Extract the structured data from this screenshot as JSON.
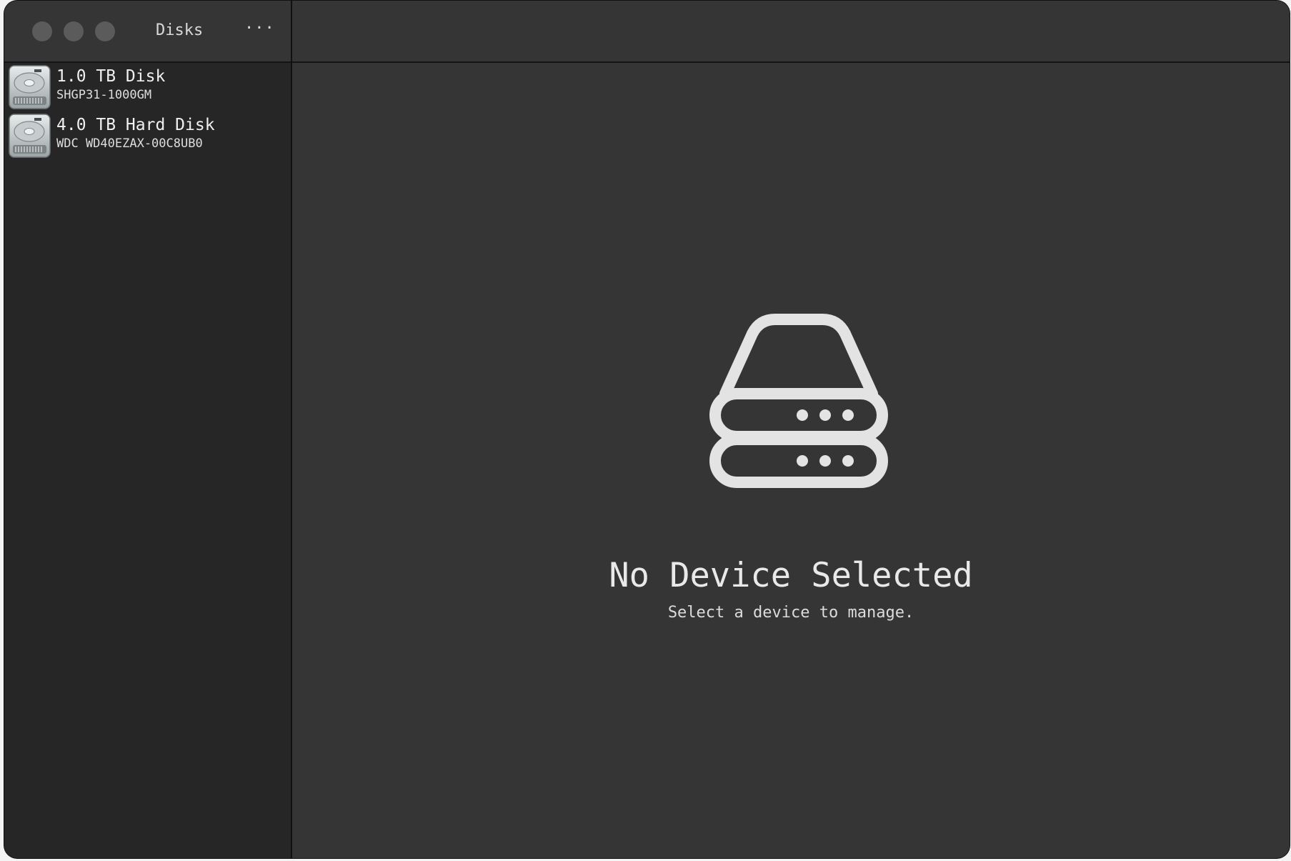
{
  "window": {
    "title": "Disks",
    "menu_label": "···",
    "traffic_lights": [
      "close-button",
      "minimize-button",
      "maximize-button"
    ]
  },
  "sidebar": {
    "disks": [
      {
        "name": "1.0 TB Disk",
        "model": "SHGP31-1000GM",
        "icon": "hard-drive-icon"
      },
      {
        "name": "4.0 TB Hard Disk",
        "model": "WDC WD40EZAX-00C8UB0",
        "icon": "hard-drive-icon"
      }
    ]
  },
  "main": {
    "empty_icon": "drive-stack-icon",
    "empty_title": "No Device Selected",
    "empty_subtitle": "Select a device to manage."
  },
  "colors": {
    "sidebar_bg": "#262626",
    "content_bg": "#353535",
    "traffic_light": "#5b5b5b",
    "text": "#e9e9e9"
  }
}
